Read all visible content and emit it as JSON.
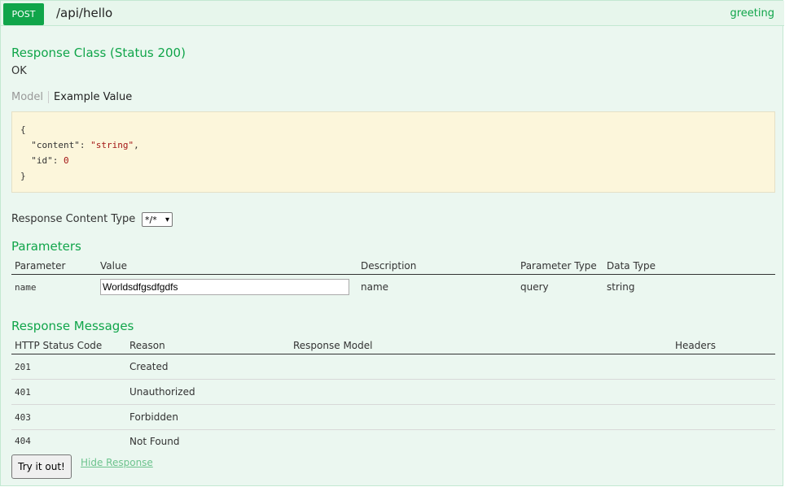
{
  "operation": {
    "method": "POST",
    "path": "/api/hello",
    "tag": "greeting"
  },
  "response_class": {
    "title": "Response Class (Status 200)",
    "description": "OK",
    "tabs": [
      "Model",
      "Example Value"
    ],
    "example": {
      "open": "{",
      "line1_key": "\"content\"",
      "line1_value": "\"string\"",
      "line2_key": "\"id\"",
      "line2_value": "0",
      "close": "}"
    }
  },
  "content_type": {
    "label": "Response Content Type",
    "selected": "*/*"
  },
  "parameters": {
    "title": "Parameters",
    "headers": [
      "Parameter",
      "Value",
      "Description",
      "Parameter Type",
      "Data Type"
    ],
    "rows": [
      {
        "name": "name",
        "value": "Worldsdfgsdfgdfs",
        "description": "name",
        "param_type": "query",
        "data_type": "string"
      }
    ]
  },
  "response_messages": {
    "title": "Response Messages",
    "headers": [
      "HTTP Status Code",
      "Reason",
      "Response Model",
      "Headers"
    ],
    "rows": [
      {
        "code": "201",
        "reason": "Created"
      },
      {
        "code": "401",
        "reason": "Unauthorized"
      },
      {
        "code": "403",
        "reason": "Forbidden"
      },
      {
        "code": "404",
        "reason": "Not Found"
      }
    ]
  },
  "actions": {
    "try_label": "Try it out!",
    "hide_label": "Hide Response"
  },
  "colors": {
    "accent": "#10a54a",
    "panel_bg": "#ebf7f0",
    "code_bg": "#fcf6db"
  }
}
